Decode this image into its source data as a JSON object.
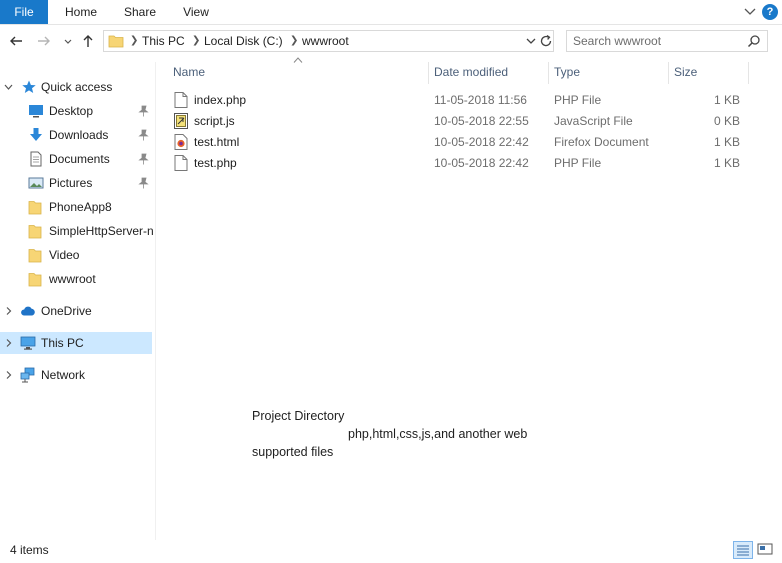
{
  "ribbon": {
    "tabs": [
      "File",
      "Home",
      "Share",
      "View"
    ],
    "help_label": "?"
  },
  "address": {
    "crumbs": [
      "This PC",
      "Local Disk (C:)",
      "wwwroot"
    ]
  },
  "search": {
    "placeholder": "Search wwwroot"
  },
  "sidebar": {
    "quick_access": "Quick access",
    "quick_items": [
      "Desktop",
      "Downloads",
      "Documents",
      "Pictures",
      "PhoneApp8",
      "SimpleHttpServer-n",
      "Video",
      "wwwroot"
    ],
    "onedrive": "OneDrive",
    "this_pc": "This PC",
    "network": "Network"
  },
  "list": {
    "columns": [
      "Name",
      "Date modified",
      "Type",
      "Size"
    ],
    "rows": [
      {
        "name": "index.php",
        "date": "11-05-2018 11:56",
        "type": "PHP File",
        "size": "1 KB",
        "icon": "php-file-icon"
      },
      {
        "name": "script.js",
        "date": "10-05-2018 22:55",
        "type": "JavaScript File",
        "size": "0 KB",
        "icon": "js-file-icon"
      },
      {
        "name": "test.html",
        "date": "10-05-2018 22:42",
        "type": "Firefox Document",
        "size": "1 KB",
        "icon": "html-file-icon"
      },
      {
        "name": "test.php",
        "date": "10-05-2018 22:42",
        "type": "PHP File",
        "size": "1 KB",
        "icon": "php-file-icon"
      }
    ]
  },
  "annotation": {
    "line1": "Project Directory",
    "line2": "php,html,css,js,and another web",
    "line3": "supported files"
  },
  "status": {
    "count": "4 items"
  },
  "colors": {
    "accent": "#1979ca",
    "selected_bg": "#cce8ff",
    "folder": "#f7d575"
  }
}
